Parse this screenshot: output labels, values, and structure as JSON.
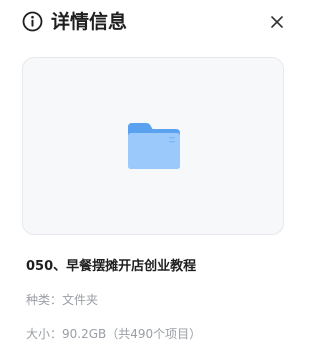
{
  "header": {
    "title": "详情信息",
    "icon": "info-circle-icon",
    "close_icon": "close-icon"
  },
  "preview": {
    "icon": "folder-icon",
    "folder_colors": {
      "back": "#5aa2f0",
      "front": "#9cc9fb"
    }
  },
  "file": {
    "name": "050、早餐摆摊开店创业教程",
    "type_label": "种类：",
    "type_value": "文件夹",
    "size_label": "大小：",
    "size_value": "90.2GB（共490个项目）"
  }
}
